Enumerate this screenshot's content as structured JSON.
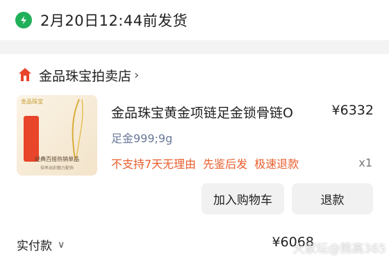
{
  "shipping": {
    "icon": "lightning-clock-icon",
    "text": "2月20日12:44前发货",
    "accent": "#21b05a"
  },
  "store": {
    "name": "金品珠宝拍卖店",
    "logo": "store-logo-icon",
    "logo_color": "#e8452a"
  },
  "product": {
    "title": "金品珠宝黄金项链足金锁骨链O",
    "price": "¥6332",
    "spec": "足金999;9g",
    "policies": [
      "不支持7天无理由",
      "先鉴后发",
      "极速退款"
    ],
    "policy_color": "#e85d2c",
    "quantity": "x1",
    "thumbnail": {
      "brand": "金品珠宝",
      "caption": "经典百搭热销单品",
      "subcaption": "倍率出彩魅力配饰"
    }
  },
  "actions": {
    "add_to_cart": "加入购物车",
    "refund": "退款"
  },
  "payment": {
    "label": "实付款",
    "amount": "¥6068",
    "watermark": "大家坛@熊高365"
  }
}
